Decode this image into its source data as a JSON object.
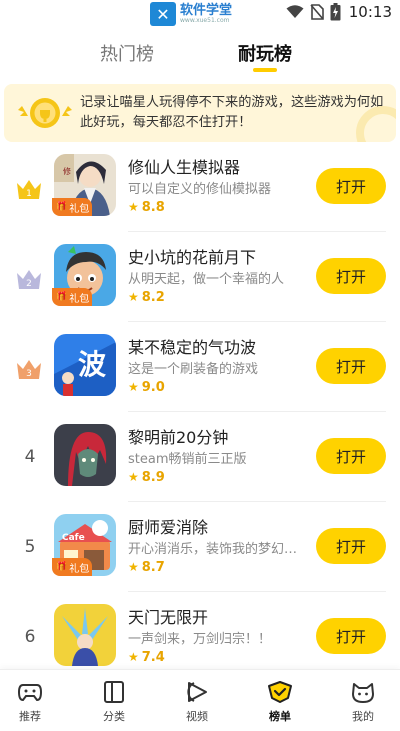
{
  "status_bar": {
    "watermark_cn": "软件学堂",
    "watermark_en": "www.xue51.com",
    "time": "10:13"
  },
  "tabs": [
    {
      "label": "热门榜",
      "active": false
    },
    {
      "label": "耐玩榜",
      "active": true
    }
  ],
  "banner": {
    "text": "记录让喵星人玩得停不下来的游戏，这些游戏为何如此好玩，每天都忍不住打开！"
  },
  "colors": {
    "accent": "#ffd200",
    "rating": "#e8a400",
    "gift_badge": "#f07a20",
    "gold": "#f5c518",
    "silver": "#b9b8dc",
    "bronze": "#f0a06a"
  },
  "games": [
    {
      "rank": "1",
      "title": "修仙人生模拟器",
      "desc": "可以自定义的修仙模拟器",
      "rating": "8.8",
      "gift": "礼包",
      "button": "打开",
      "icon": "cultivation-game-icon"
    },
    {
      "rank": "2",
      "title": "史小坑的花前月下",
      "desc": "从明天起，做一个幸福的人",
      "rating": "8.2",
      "gift": "礼包",
      "button": "打开",
      "icon": "cartoon-boy-game-icon"
    },
    {
      "rank": "3",
      "title": "某不稳定的气功波",
      "desc": "这是一个刷装备的游戏",
      "rating": "9.0",
      "gift": "",
      "button": "打开",
      "icon": "wave-character-game-icon"
    },
    {
      "rank": "4",
      "title": "黎明前20分钟",
      "desc": "steam畅销前三正版",
      "rating": "8.9",
      "gift": "",
      "button": "打开",
      "icon": "red-hair-game-icon"
    },
    {
      "rank": "5",
      "title": "厨师爱消除",
      "desc": "开心消消乐，装饰我的梦幻…",
      "rating": "8.7",
      "gift": "礼包",
      "button": "打开",
      "icon": "cafe-game-icon"
    },
    {
      "rank": "6",
      "title": "天门无限开",
      "desc": "一声剑来，万剑归宗！！",
      "rating": "7.4",
      "gift": "",
      "button": "打开",
      "icon": "sword-game-icon"
    }
  ],
  "bottom_nav": [
    {
      "label": "推荐",
      "icon": "gamepad-icon",
      "active": false
    },
    {
      "label": "分类",
      "icon": "category-icon",
      "active": false
    },
    {
      "label": "视频",
      "icon": "video-icon",
      "active": false
    },
    {
      "label": "榜单",
      "icon": "ranking-icon",
      "active": true
    },
    {
      "label": "我的",
      "icon": "cat-face-icon",
      "active": false
    }
  ]
}
